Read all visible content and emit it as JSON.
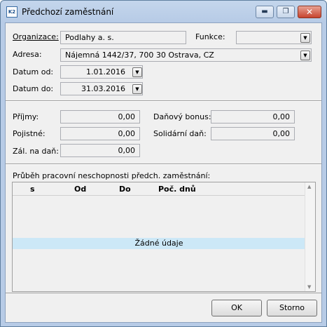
{
  "window": {
    "title": "Předchozí zaměstnání",
    "icon_text": "K2",
    "min_glyph": "▬",
    "max_glyph": "❐",
    "close_glyph": "✕"
  },
  "form": {
    "organizace_label": "Organizace:",
    "organizace_value": "Podlahy a. s.",
    "funkce_label": "Funkce:",
    "funkce_value": "",
    "adresa_label": "Adresa:",
    "adresa_value": "Nájemná 1442/37, 700 30  Ostrava, CZ",
    "datum_od_label": "Datum od:",
    "datum_od_value": "1.01.2016",
    "datum_do_label": "Datum do:",
    "datum_do_value": "31.03.2016"
  },
  "amounts": {
    "prijmy_label": "Příjmy:",
    "prijmy_value": "0,00",
    "pojistne_label": "Pojistné:",
    "pojistne_value": "0,00",
    "zal_label": "Zál. na daň:",
    "zal_value": "0,00",
    "danovy_bonus_label": "Daňový bonus:",
    "danovy_bonus_value": "0,00",
    "solidarni_label": "Solidární daň:",
    "solidarni_value": "0,00"
  },
  "sickness": {
    "title": "Průběh pracovní neschopnosti předch. zaměstnání:",
    "columns": [
      "s",
      "Od",
      "Do",
      "Poč. dnů"
    ],
    "empty_text": "Žádné údaje"
  },
  "buttons": {
    "ok": "OK",
    "cancel": "Storno"
  },
  "icons": {
    "dropdown": "chevron-down-icon"
  }
}
